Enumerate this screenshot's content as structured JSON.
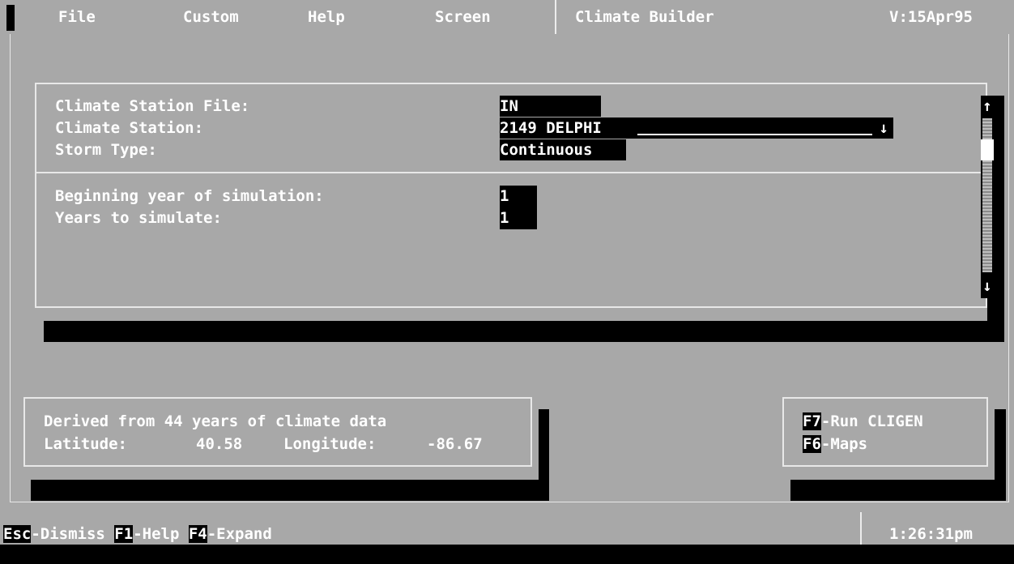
{
  "menu": {
    "items": [
      "File",
      "Custom",
      "Help",
      "Screen"
    ],
    "app_title": "Climate Builder",
    "version": "V:15Apr95"
  },
  "dialog": {
    "station_file_label": "Climate Station File:",
    "station_file_value": "IN",
    "station_label": "Climate Station:",
    "station_value": "2149 DELPHI",
    "station_arrow": "↓",
    "storm_type_label": "Storm Type:",
    "storm_type_value": "Continuous",
    "begin_year_label": "Beginning year of simulation:",
    "begin_year_value": "1",
    "years_label": "Years to simulate:",
    "years_value": "1",
    "scroll_up": "↑",
    "scroll_down": "↓"
  },
  "info": {
    "derived": "Derived from 44 years of climate data",
    "latitude_label": "Latitude:",
    "latitude": "40.58",
    "longitude_label": "Longitude:",
    "longitude": "-86.67"
  },
  "function_keys": [
    {
      "key": "F7",
      "label": "-Run CLIGEN"
    },
    {
      "key": "F6",
      "label": "-Maps"
    }
  ],
  "status": {
    "keys": [
      {
        "key": "Esc",
        "label": "-Dismiss"
      },
      {
        "key": "F1",
        "label": "-Help"
      },
      {
        "key": "F4",
        "label": "-Expand"
      }
    ],
    "time": "1:26:31pm"
  }
}
